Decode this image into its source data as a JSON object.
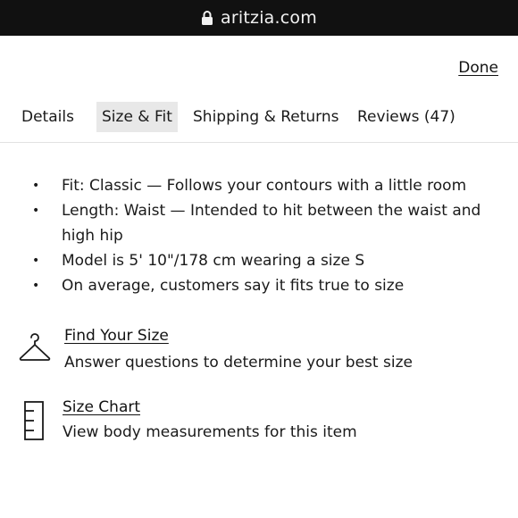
{
  "browser": {
    "url": "aritzia.com",
    "lock_icon": "lock-icon"
  },
  "header": {
    "done_label": "Done"
  },
  "tabs": [
    {
      "label": "Details",
      "active": false
    },
    {
      "label": "Size & Fit",
      "active": true
    },
    {
      "label": "Shipping & Returns",
      "active": false
    },
    {
      "label": "Reviews (47)",
      "active": false
    }
  ],
  "fit_details": [
    "Fit: Classic — Follows your contours with a little room",
    "Length: Waist — Intended to hit between the waist and high hip",
    "Model is 5' 10\"/178 cm wearing a size S",
    "On average, customers say it fits true to size"
  ],
  "size_tools": [
    {
      "icon": "hanger-icon",
      "link": "Find Your Size",
      "description": "Answer questions to determine your best size"
    },
    {
      "icon": "ruler-icon",
      "link": "Size Chart",
      "description": "View body measurements for this item"
    }
  ],
  "colors": {
    "url_bar": "#111111",
    "active_tab": "#e8e8e8",
    "text": "#1a1a1a"
  }
}
